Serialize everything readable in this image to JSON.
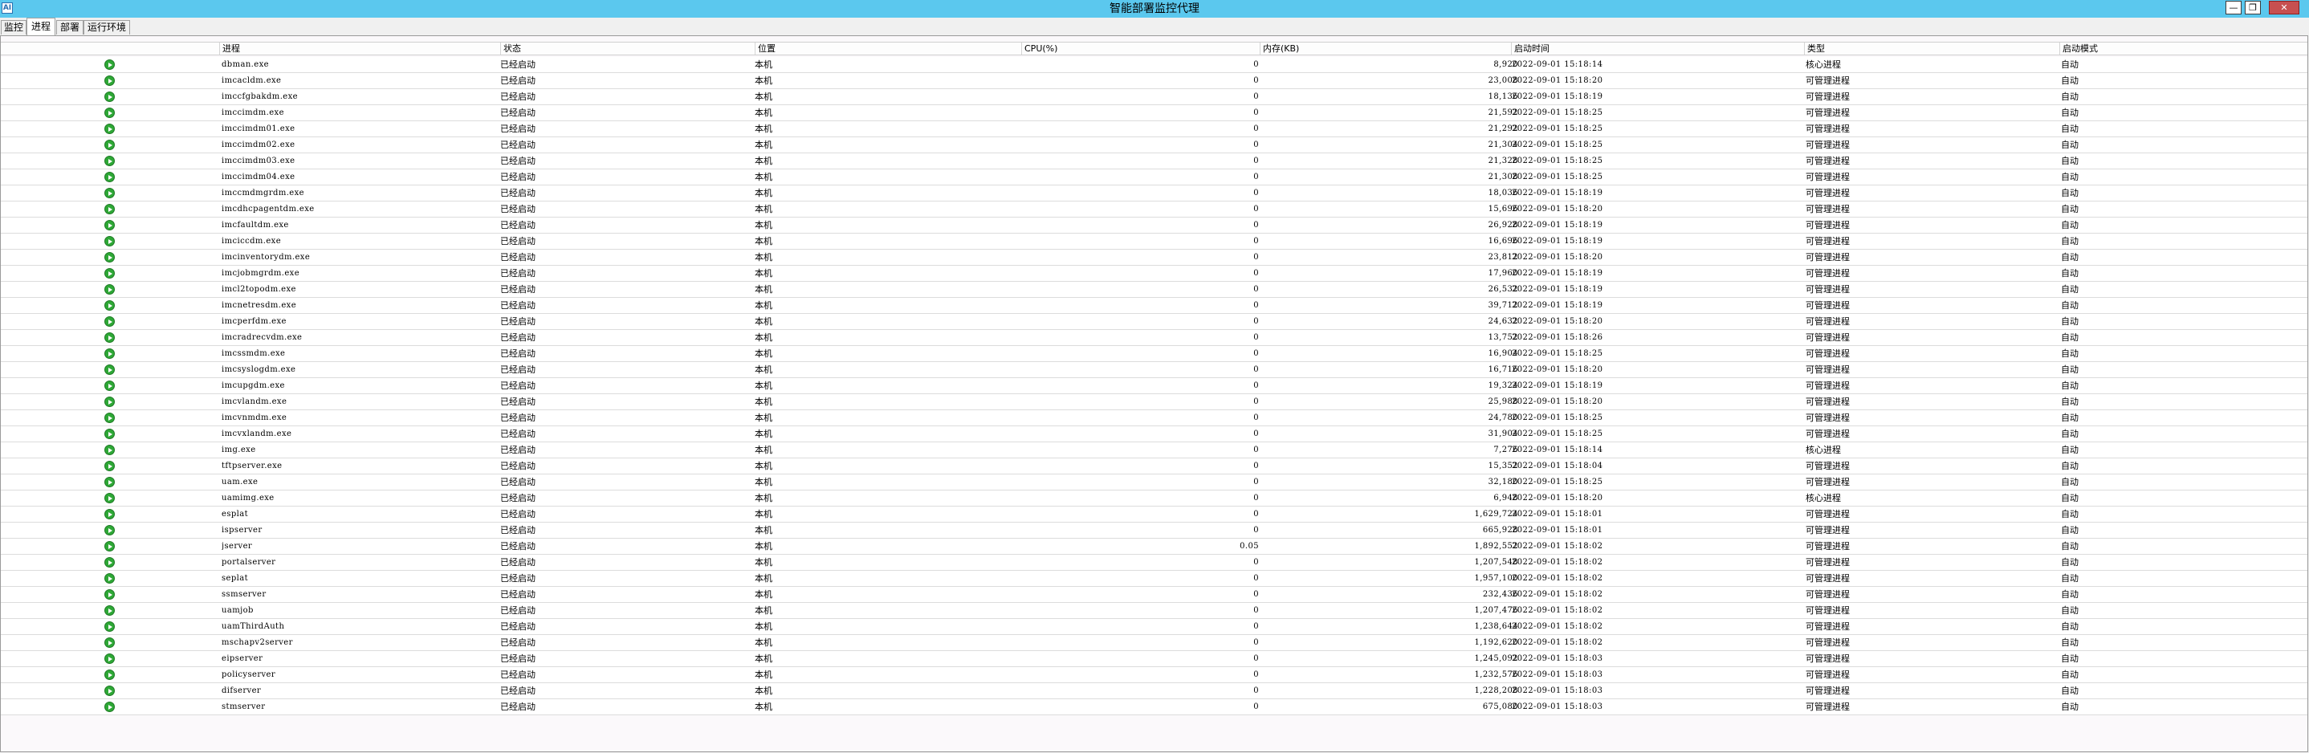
{
  "window": {
    "title": "智能部署监控代理",
    "icon": "app-icon",
    "icon_text": "AI",
    "minimize": "—",
    "restore": "❐",
    "close": "✕"
  },
  "tabs": [
    {
      "label": "监控",
      "active": false
    },
    {
      "label": "进程",
      "active": true
    },
    {
      "label": "部署",
      "active": false
    },
    {
      "label": "运行环境",
      "active": false
    }
  ],
  "columns": [
    "进程",
    "状态",
    "位置",
    "CPU(%)",
    "内存(KB)",
    "启动时间",
    "类型",
    "启动模式"
  ],
  "colors": {
    "titlebar": "#5bc8ee",
    "status_running": "#2ea836"
  },
  "rows": [
    {
      "name": "dbman.exe",
      "status": "已经启动",
      "location": "本机",
      "cpu": "0",
      "mem": "8,920",
      "time": "2022-09-01 15:18:14",
      "type": "核心进程",
      "mode": "自动"
    },
    {
      "name": "imcacldm.exe",
      "status": "已经启动",
      "location": "本机",
      "cpu": "0",
      "mem": "23,008",
      "time": "2022-09-01 15:18:20",
      "type": "可管理进程",
      "mode": "自动"
    },
    {
      "name": "imccfgbakdm.exe",
      "status": "已经启动",
      "location": "本机",
      "cpu": "0",
      "mem": "18,136",
      "time": "2022-09-01 15:18:19",
      "type": "可管理进程",
      "mode": "自动"
    },
    {
      "name": "imccimdm.exe",
      "status": "已经启动",
      "location": "本机",
      "cpu": "0",
      "mem": "21,592",
      "time": "2022-09-01 15:18:25",
      "type": "可管理进程",
      "mode": "自动"
    },
    {
      "name": "imccimdm01.exe",
      "status": "已经启动",
      "location": "本机",
      "cpu": "0",
      "mem": "21,292",
      "time": "2022-09-01 15:18:25",
      "type": "可管理进程",
      "mode": "自动"
    },
    {
      "name": "imccimdm02.exe",
      "status": "已经启动",
      "location": "本机",
      "cpu": "0",
      "mem": "21,304",
      "time": "2022-09-01 15:18:25",
      "type": "可管理进程",
      "mode": "自动"
    },
    {
      "name": "imccimdm03.exe",
      "status": "已经启动",
      "location": "本机",
      "cpu": "0",
      "mem": "21,328",
      "time": "2022-09-01 15:18:25",
      "type": "可管理进程",
      "mode": "自动"
    },
    {
      "name": "imccimdm04.exe",
      "status": "已经启动",
      "location": "本机",
      "cpu": "0",
      "mem": "21,308",
      "time": "2022-09-01 15:18:25",
      "type": "可管理进程",
      "mode": "自动"
    },
    {
      "name": "imccmdmgrdm.exe",
      "status": "已经启动",
      "location": "本机",
      "cpu": "0",
      "mem": "18,036",
      "time": "2022-09-01 15:18:19",
      "type": "可管理进程",
      "mode": "自动"
    },
    {
      "name": "imcdhcpagentdm.exe",
      "status": "已经启动",
      "location": "本机",
      "cpu": "0",
      "mem": "15,696",
      "time": "2022-09-01 15:18:20",
      "type": "可管理进程",
      "mode": "自动"
    },
    {
      "name": "imcfaultdm.exe",
      "status": "已经启动",
      "location": "本机",
      "cpu": "0",
      "mem": "26,928",
      "time": "2022-09-01 15:18:19",
      "type": "可管理进程",
      "mode": "自动"
    },
    {
      "name": "imciccdm.exe",
      "status": "已经启动",
      "location": "本机",
      "cpu": "0",
      "mem": "16,696",
      "time": "2022-09-01 15:18:19",
      "type": "可管理进程",
      "mode": "自动"
    },
    {
      "name": "imcinventorydm.exe",
      "status": "已经启动",
      "location": "本机",
      "cpu": "0",
      "mem": "23,812",
      "time": "2022-09-01 15:18:20",
      "type": "可管理进程",
      "mode": "自动"
    },
    {
      "name": "imcjobmgrdm.exe",
      "status": "已经启动",
      "location": "本机",
      "cpu": "0",
      "mem": "17,960",
      "time": "2022-09-01 15:18:19",
      "type": "可管理进程",
      "mode": "自动"
    },
    {
      "name": "imcl2topodm.exe",
      "status": "已经启动",
      "location": "本机",
      "cpu": "0",
      "mem": "26,532",
      "time": "2022-09-01 15:18:19",
      "type": "可管理进程",
      "mode": "自动"
    },
    {
      "name": "imcnetresdm.exe",
      "status": "已经启动",
      "location": "本机",
      "cpu": "0",
      "mem": "39,712",
      "time": "2022-09-01 15:18:19",
      "type": "可管理进程",
      "mode": "自动"
    },
    {
      "name": "imcperfdm.exe",
      "status": "已经启动",
      "location": "本机",
      "cpu": "0",
      "mem": "24,632",
      "time": "2022-09-01 15:18:20",
      "type": "可管理进程",
      "mode": "自动"
    },
    {
      "name": "imcradrecvdm.exe",
      "status": "已经启动",
      "location": "本机",
      "cpu": "0",
      "mem": "13,752",
      "time": "2022-09-01 15:18:26",
      "type": "可管理进程",
      "mode": "自动"
    },
    {
      "name": "imcssmdm.exe",
      "status": "已经启动",
      "location": "本机",
      "cpu": "0",
      "mem": "16,904",
      "time": "2022-09-01 15:18:25",
      "type": "可管理进程",
      "mode": "自动"
    },
    {
      "name": "imcsyslogdm.exe",
      "status": "已经启动",
      "location": "本机",
      "cpu": "0",
      "mem": "16,716",
      "time": "2022-09-01 15:18:20",
      "type": "可管理进程",
      "mode": "自动"
    },
    {
      "name": "imcupgdm.exe",
      "status": "已经启动",
      "location": "本机",
      "cpu": "0",
      "mem": "19,324",
      "time": "2022-09-01 15:18:19",
      "type": "可管理进程",
      "mode": "自动"
    },
    {
      "name": "imcvlandm.exe",
      "status": "已经启动",
      "location": "本机",
      "cpu": "0",
      "mem": "25,988",
      "time": "2022-09-01 15:18:20",
      "type": "可管理进程",
      "mode": "自动"
    },
    {
      "name": "imcvnmdm.exe",
      "status": "已经启动",
      "location": "本机",
      "cpu": "0",
      "mem": "24,780",
      "time": "2022-09-01 15:18:25",
      "type": "可管理进程",
      "mode": "自动"
    },
    {
      "name": "imcvxlandm.exe",
      "status": "已经启动",
      "location": "本机",
      "cpu": "0",
      "mem": "31,904",
      "time": "2022-09-01 15:18:25",
      "type": "可管理进程",
      "mode": "自动"
    },
    {
      "name": "img.exe",
      "status": "已经启动",
      "location": "本机",
      "cpu": "0",
      "mem": "7,276",
      "time": "2022-09-01 15:18:14",
      "type": "核心进程",
      "mode": "自动"
    },
    {
      "name": "tftpserver.exe",
      "status": "已经启动",
      "location": "本机",
      "cpu": "0",
      "mem": "15,352",
      "time": "2022-09-01 15:18:04",
      "type": "可管理进程",
      "mode": "自动"
    },
    {
      "name": "uam.exe",
      "status": "已经启动",
      "location": "本机",
      "cpu": "0",
      "mem": "32,180",
      "time": "2022-09-01 15:18:25",
      "type": "可管理进程",
      "mode": "自动"
    },
    {
      "name": "uamimg.exe",
      "status": "已经启动",
      "location": "本机",
      "cpu": "0",
      "mem": "6,948",
      "time": "2022-09-01 15:18:20",
      "type": "核心进程",
      "mode": "自动"
    },
    {
      "name": "esplat",
      "status": "已经启动",
      "location": "本机",
      "cpu": "0",
      "mem": "1,629,724",
      "time": "2022-09-01 15:18:01",
      "type": "可管理进程",
      "mode": "自动"
    },
    {
      "name": "ispserver",
      "status": "已经启动",
      "location": "本机",
      "cpu": "0",
      "mem": "665,928",
      "time": "2022-09-01 15:18:01",
      "type": "可管理进程",
      "mode": "自动"
    },
    {
      "name": "jserver",
      "status": "已经启动",
      "location": "本机",
      "cpu": "0.05",
      "mem": "1,892,552",
      "time": "2022-09-01 15:18:02",
      "type": "可管理进程",
      "mode": "自动"
    },
    {
      "name": "portalserver",
      "status": "已经启动",
      "location": "本机",
      "cpu": "0",
      "mem": "1,207,548",
      "time": "2022-09-01 15:18:02",
      "type": "可管理进程",
      "mode": "自动"
    },
    {
      "name": "seplat",
      "status": "已经启动",
      "location": "本机",
      "cpu": "0",
      "mem": "1,957,100",
      "time": "2022-09-01 15:18:02",
      "type": "可管理进程",
      "mode": "自动"
    },
    {
      "name": "ssmserver",
      "status": "已经启动",
      "location": "本机",
      "cpu": "0",
      "mem": "232,436",
      "time": "2022-09-01 15:18:02",
      "type": "可管理进程",
      "mode": "自动"
    },
    {
      "name": "uamjob",
      "status": "已经启动",
      "location": "本机",
      "cpu": "0",
      "mem": "1,207,476",
      "time": "2022-09-01 15:18:02",
      "type": "可管理进程",
      "mode": "自动"
    },
    {
      "name": "uamThirdAuth",
      "status": "已经启动",
      "location": "本机",
      "cpu": "0",
      "mem": "1,238,644",
      "time": "2022-09-01 15:18:02",
      "type": "可管理进程",
      "mode": "自动"
    },
    {
      "name": "mschapv2server",
      "status": "已经启动",
      "location": "本机",
      "cpu": "0",
      "mem": "1,192,620",
      "time": "2022-09-01 15:18:02",
      "type": "可管理进程",
      "mode": "自动"
    },
    {
      "name": "eipserver",
      "status": "已经启动",
      "location": "本机",
      "cpu": "0",
      "mem": "1,245,092",
      "time": "2022-09-01 15:18:03",
      "type": "可管理进程",
      "mode": "自动"
    },
    {
      "name": "policyserver",
      "status": "已经启动",
      "location": "本机",
      "cpu": "0",
      "mem": "1,232,576",
      "time": "2022-09-01 15:18:03",
      "type": "可管理进程",
      "mode": "自动"
    },
    {
      "name": "difserver",
      "status": "已经启动",
      "location": "本机",
      "cpu": "0",
      "mem": "1,228,208",
      "time": "2022-09-01 15:18:03",
      "type": "可管理进程",
      "mode": "自动"
    },
    {
      "name": "stmserver",
      "status": "已经启动",
      "location": "本机",
      "cpu": "0",
      "mem": "675,080",
      "time": "2022-09-01 15:18:03",
      "type": "可管理进程",
      "mode": "自动"
    }
  ]
}
